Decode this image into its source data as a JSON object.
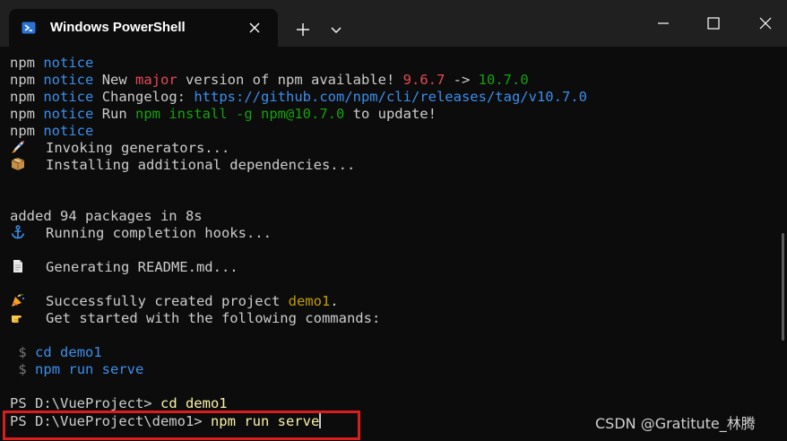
{
  "window": {
    "tab_title": "Windows PowerShell",
    "new_tab_glyph": "+",
    "icons": {
      "tab": "powershell-icon",
      "close_tab": "close-icon",
      "new_tab": "plus-icon",
      "dropdown": "chevron-down-icon",
      "minimize": "minimize-icon",
      "maximize": "maximize-icon",
      "close_window": "close-icon"
    }
  },
  "terminal": {
    "colors": {
      "background": "#0c0c0c",
      "text": "#cccccc",
      "blue": "#3b8eea",
      "red": "#e74856",
      "green": "#13a10e",
      "yellow": "#f9f1a5",
      "orange": "#c19c00",
      "highlight_box": "#d91e1e"
    },
    "npm_notice": {
      "npm": "npm",
      "notice": "notice",
      "new_prefix": "New ",
      "major": "major",
      "version_text": " version of npm available! ",
      "old_version": "9.6.7",
      "arrow": " -> ",
      "new_version": "10.7.0",
      "changelog_label": "Changelog: ",
      "changelog_url": "https://github.com/npm/cli/releases/tag/v10.7.0",
      "run_label": "Run ",
      "install_cmd": "npm install -g npm@10.7.0",
      "to_update": " to update!"
    },
    "vue_cli": {
      "invoking": "Invoking generators...",
      "installing": "Installing additional dependencies...",
      "added": "added 94 packages in 8s",
      "running_hooks": "Running completion hooks...",
      "generating_readme": "Generating README.md...",
      "success_prefix": "Successfully created project ",
      "project_name": "demo1",
      "success_suffix": ".",
      "get_started": "Get started with the following commands:",
      "dollar": "$",
      "cmd_cd": "cd demo1",
      "cmd_serve": "npm run serve"
    },
    "history": {
      "prompt1": "PS D:\\VueProject> ",
      "command1": "cd demo1",
      "prompt2": "PS D:\\VueProject\\demo1> ",
      "command2": "npm run serve"
    },
    "emoji_icons": [
      "rocket-icon",
      "package-icon",
      "anchor-icon",
      "page-icon",
      "party-popper-icon",
      "pointing-hand-icon"
    ]
  },
  "watermark": "CSDN @Gratitute_林腾"
}
